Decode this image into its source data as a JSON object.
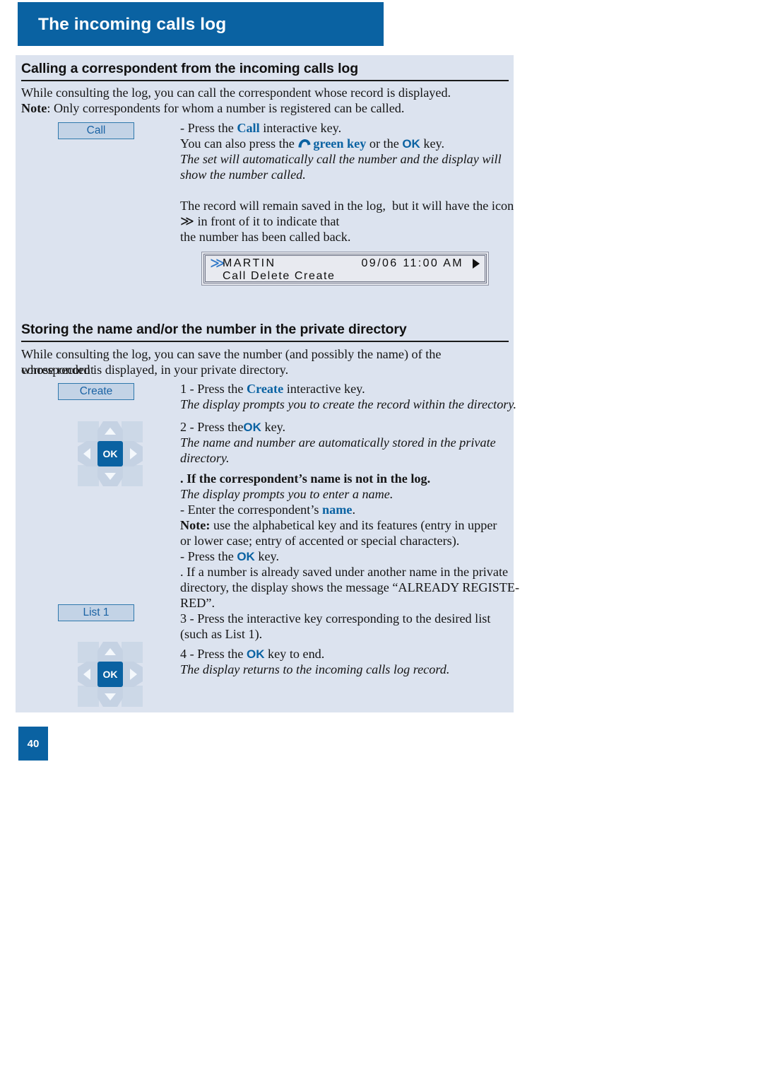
{
  "chapter": {
    "title": "The incoming calls log"
  },
  "sections": [
    {
      "heading": "Calling a correspondent from the incoming calls log",
      "intro_line1": "While consulting the log, you can call the correspondent whose record is displayed.",
      "note_label": "Note",
      "note_rest": ": Only correspondents for whom a number is registered can be called.",
      "softkey": "Call",
      "step1_pre": "- Press the ",
      "step1_key": "Call",
      "step1_post": " interactive key.",
      "step2_pre": "You can also press the ",
      "step2_green": "green key",
      "step2_mid": " or the ",
      "step2_ok": "OK",
      "step2_post": " key.",
      "italic1": "The set will automatically call the number and the display will",
      "italic2": "show the number called.",
      "para1": "The record will remain saved in the log,  but it will have the icon",
      "para2_icon": "≫",
      "para2_rest": " in front of it to indicate that",
      "para3": "the number has been called back."
    },
    {
      "heading": "Storing the name and/or the number in the private directory",
      "intro_line1": "While consulting the log, you can save the number (and possibly the name) of the correspondent",
      "intro_line2": "whose record is displayed, in your private directory.",
      "softkey_create": "Create",
      "step1_pre": "1 - Press the ",
      "step1_key": "Create",
      "step1_post": " interactive key.",
      "step1_italic": "The display prompts you to create the record within the directory.",
      "step2_pre": "2 - Press the",
      "step2_key": "OK",
      "step2_post": " key.",
      "step2_italic1": "The name and number are automatically stored in the private",
      "step2_italic2": "directory.",
      "subhead": ". If the correspondent’s name is not in the log.",
      "sub_italic": "The display prompts you to enter a name.",
      "sub_line1_pre": "- Enter the correspondent’s ",
      "sub_line1_key": "name",
      "sub_line1_post": ".",
      "sub_note_label": "Note:",
      "sub_note_line1": " use the alphabetical key and its features (entry in upper",
      "sub_note_line2": "or lower case; entry of accented or special characters).",
      "sub_press_pre": "- Press the ",
      "sub_press_key": "OK",
      "sub_press_post": " key.",
      "sub_warn_line1": ". If a number is already saved under another name in the private",
      "sub_warn_line2": "directory, the display shows the message “ALREADY REGISTE-",
      "sub_warn_line3": "RED”.",
      "softkey_list": "List 1",
      "step3_line1": "3 - Press the interactive key corresponding to the desired list",
      "step3_line2": "(such as List 1).",
      "step4_pre": "4 - Press the ",
      "step4_key": "OK",
      "step4_post": " key to end.",
      "step4_italic": "The display returns to the incoming calls log record."
    }
  ],
  "lcd": {
    "chevron": "≫",
    "name": "MARTIN",
    "datetime": "09/06 11:00 AM",
    "softkeys": "Call      Delete     Create"
  },
  "navpad": {
    "ok_label": "OK"
  },
  "footer": {
    "page_number": "40"
  },
  "colors": {
    "brand_blue": "#0a62a2",
    "panel_bg": "#dce3ef",
    "softkey_fill": "#c3d3e6",
    "softkey_border": "#2f78ac",
    "navpad_arm": "#c5d2e3"
  }
}
